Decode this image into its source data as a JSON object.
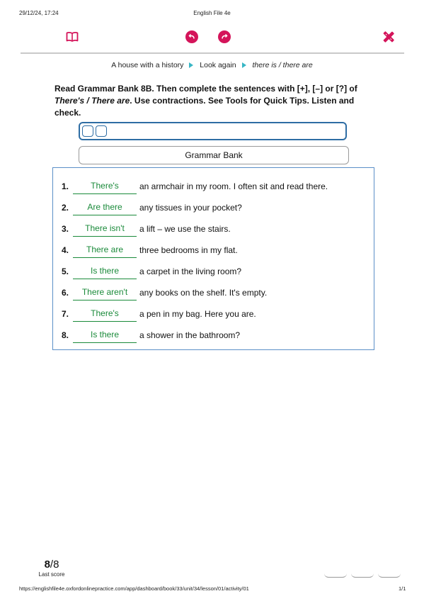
{
  "print_header": {
    "date": "29/12/24, 17:24",
    "title": "English File 4e"
  },
  "toolbar": {
    "icons": [
      "book-icon",
      "undo-icon",
      "redo-icon",
      "tools-icon"
    ],
    "accent_color": "#d4145a"
  },
  "breadcrumb": {
    "items": [
      "A house with a history",
      "Look again",
      "there is / there are"
    ]
  },
  "instructions": {
    "part1": "Read Grammar Bank 8B. Then complete the sentences with [+], [–] or [?] of ",
    "italic": "There's / There are",
    "part2": ". Use contractions. See Tools for Quick Tips. Listen and check."
  },
  "grammar_bank_button": "Grammar Bank",
  "exercise": {
    "items": [
      {
        "num": "1.",
        "answer": "There's",
        "text": "an armchair in my room. I often sit and read there."
      },
      {
        "num": "2.",
        "answer": "Are there",
        "text": "any tissues in your pocket?"
      },
      {
        "num": "3.",
        "answer": "There isn't",
        "text": "a lift – we use the stairs."
      },
      {
        "num": "4.",
        "answer": "There are",
        "text": "three bedrooms in my flat."
      },
      {
        "num": "5.",
        "answer": "Is there",
        "text": "a carpet in the living room?"
      },
      {
        "num": "6.",
        "answer": "There aren't",
        "text": "any books on the shelf. It's empty."
      },
      {
        "num": "7.",
        "answer": "There's",
        "text": "a pen in my bag. Here you are."
      },
      {
        "num": "8.",
        "answer": "Is there",
        "text": "a shower in the bathroom?"
      }
    ],
    "answer_color": "#1a8a3a"
  },
  "score": {
    "value": "8",
    "total": "/8",
    "label": "Last score"
  },
  "footer": {
    "url": "https://englishfile4e.oxfordonlinepractice.com/app/dashboard/book/33/unit/34/lesson/01/activity/01",
    "page": "1/1"
  }
}
